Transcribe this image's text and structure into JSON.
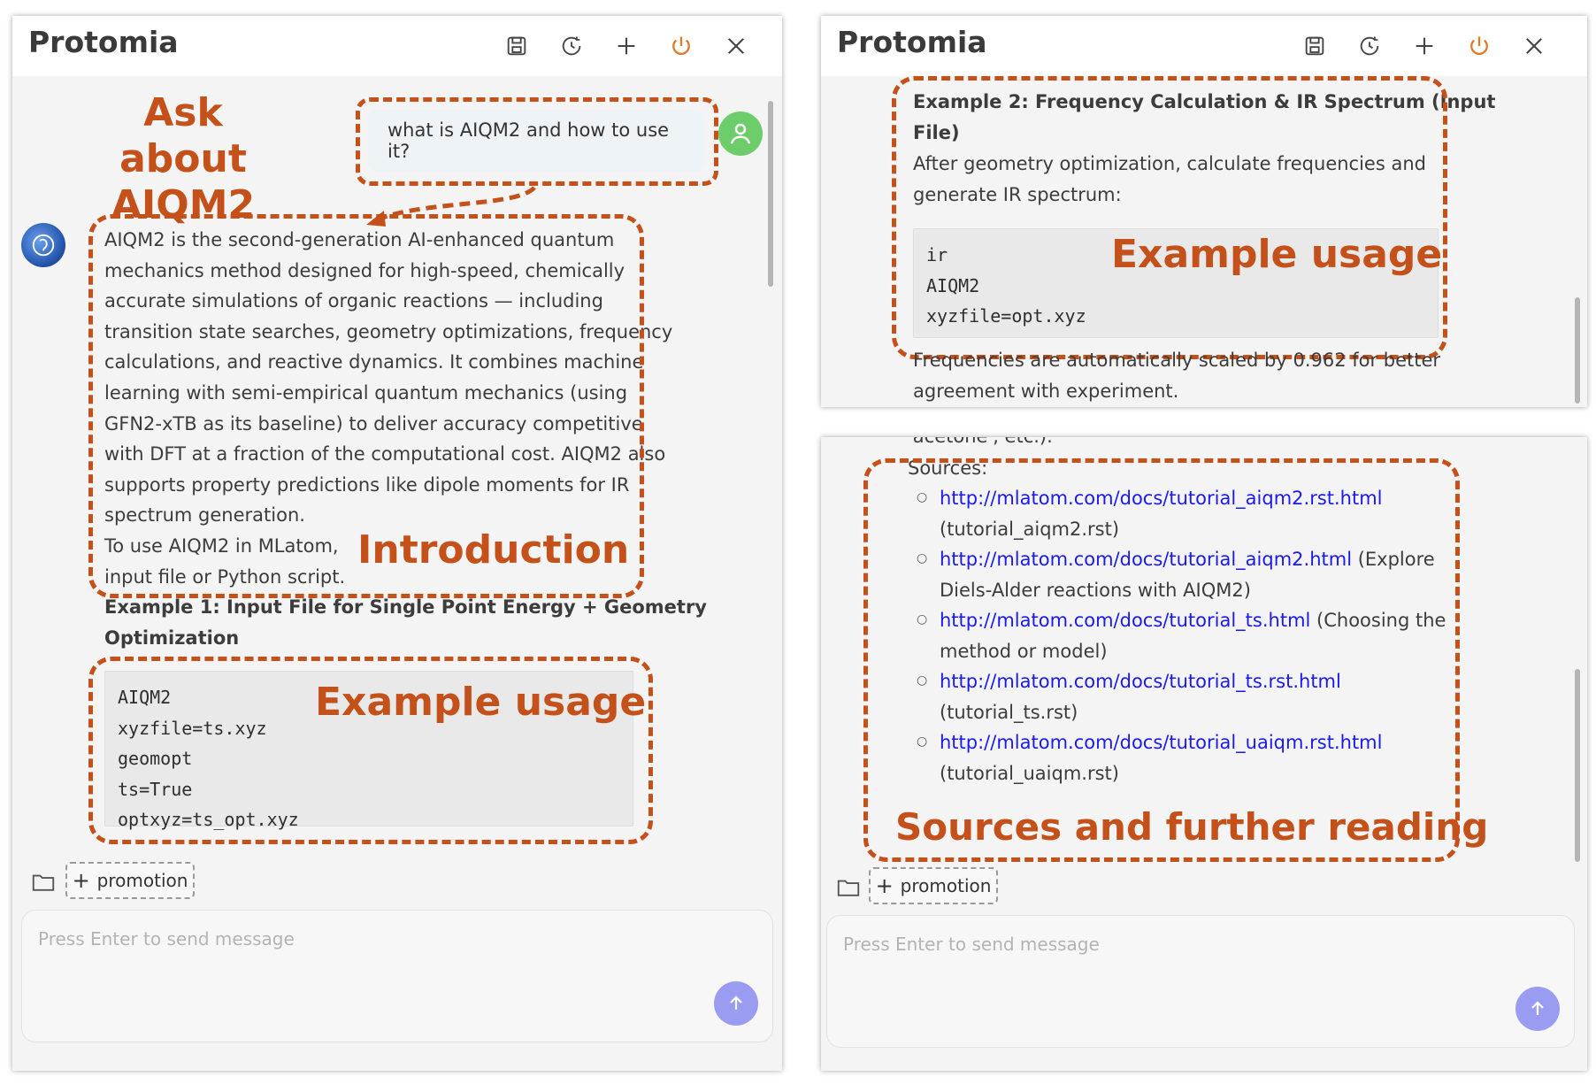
{
  "app": {
    "title": "Protomia",
    "placeholder": "Press Enter to send message",
    "promotion_label": "promotion"
  },
  "colors": {
    "accent_annotation": "#c4501a",
    "user_avatar": "#6ccd6a",
    "send_button": "#9a9cf2",
    "link": "#1a1aee",
    "power_icon": "#e07a2a"
  },
  "left": {
    "annotation_ask_line1": "Ask about",
    "annotation_ask_line2": "AIQM2",
    "user_message": "what is AIQM2 and how to use it?",
    "intro_lines": [
      "AIQM2 is the second-generation AI-enhanced quantum",
      "mechanics method designed for high-speed, chemically",
      "accurate simulations of organic reactions — including",
      "transition state searches, geometry optimizations, frequency",
      "calculations, and reactive dynamics. It combines machine",
      "learning with semi-empirical quantum mechanics (using",
      "GFN2-xTB as its baseline) to deliver accuracy competitive",
      "with DFT at a fraction of the computational cost. AIQM2 also",
      "supports property predictions like dipole moments for IR",
      "spectrum generation.",
      "To use AIQM2 in MLatom,",
      "input file or Python script."
    ],
    "annotation_intro": "Introduction",
    "example1_title_line1": "Example 1: Input File for Single Point Energy + Geometry",
    "example1_title_line2": "Optimization",
    "code1": [
      "AIQM2",
      "xyzfile=ts.xyz",
      "geomopt",
      "ts=True",
      "optxyz=ts_opt.xyz"
    ],
    "annotation_example": "Example usage"
  },
  "right_top": {
    "example2_title_line1": "Example 2: Frequency Calculation & IR Spectrum (Input",
    "example2_title_line2": "File)",
    "example2_desc_line1": "After geometry optimization, calculate frequencies and",
    "example2_desc_line2": "generate IR spectrum:",
    "code2": [
      "ir",
      "AIQM2",
      "xyzfile=opt.xyz"
    ],
    "annotation_example": "Example usage",
    "after_line1": "Frequencies are automatically scaled by 0.962 for better",
    "after_line2": "agreement with experiment."
  },
  "right_bottom": {
    "cut_line": "'acetone', etc.).",
    "sources_label": "Sources:",
    "sources": [
      {
        "url": "http://mlatom.com/docs/tutorial_aiqm2.rst.html",
        "rest_line1": "",
        "rest_line2": "(tutorial_aiqm2.rst)"
      },
      {
        "url": "http://mlatom.com/docs/tutorial_aiqm2.html",
        "rest_line1": " (Explore",
        "rest_line2": "Diels-Alder reactions with AIQM2)"
      },
      {
        "url": "http://mlatom.com/docs/tutorial_ts.html",
        "rest_line1": " (Choosing the",
        "rest_line2": "method or model)"
      },
      {
        "url": "http://mlatom.com/docs/tutorial_ts.rst.html",
        "rest_line1": "",
        "rest_line2": "(tutorial_ts.rst)"
      },
      {
        "url": "http://mlatom.com/docs/tutorial_uaiqm.rst.html",
        "rest_line1": "",
        "rest_line2": "(tutorial_uaiqm.rst)"
      }
    ],
    "annotation_sources": "Sources and further reading"
  }
}
